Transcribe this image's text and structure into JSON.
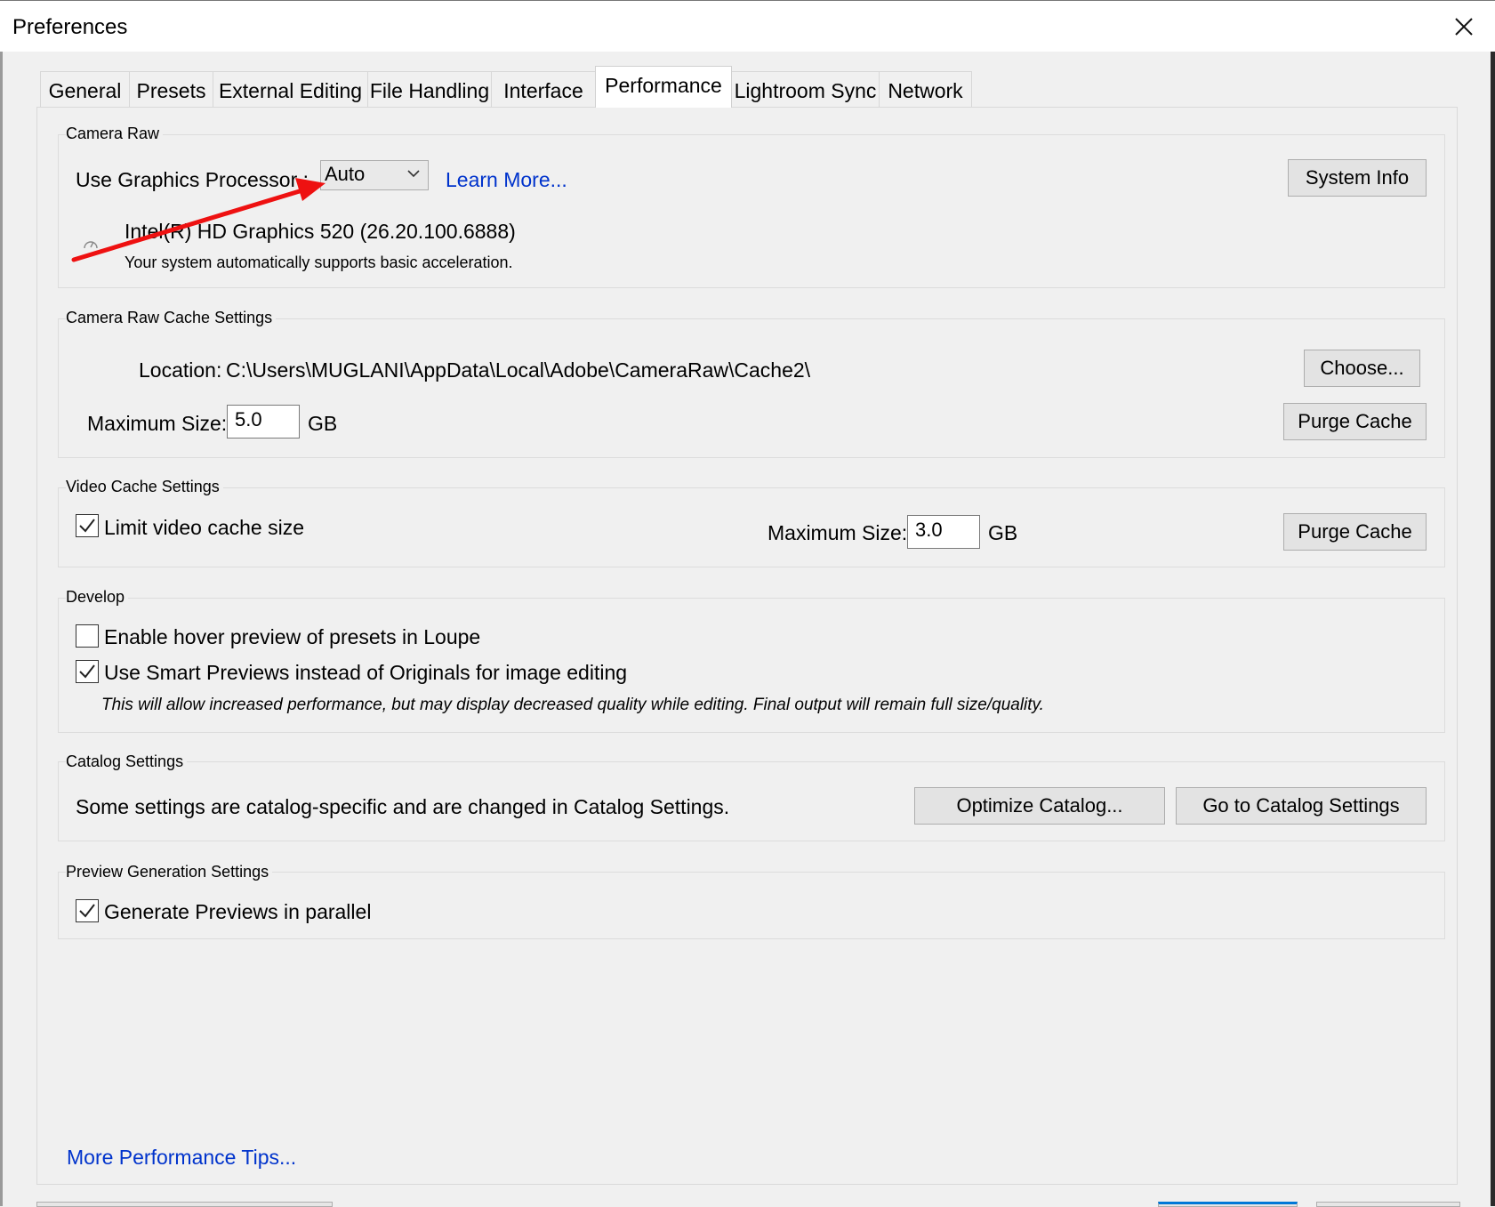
{
  "window": {
    "title": "Preferences"
  },
  "tabs": [
    {
      "label": "General"
    },
    {
      "label": "Presets"
    },
    {
      "label": "External Editing"
    },
    {
      "label": "File Handling"
    },
    {
      "label": "Interface"
    },
    {
      "label": "Performance",
      "active": true
    },
    {
      "label": "Lightroom Sync"
    },
    {
      "label": "Network"
    }
  ],
  "camera_raw": {
    "legend": "Camera Raw",
    "gpu_label": "Use Graphics Processor :",
    "gpu_value": "Auto",
    "learn_more": "Learn More...",
    "system_info": "System Info",
    "gpu_name": "Intel(R) HD Graphics 520 (26.20.100.6888)",
    "gpu_status": "Your system automatically supports basic acceleration."
  },
  "camera_raw_cache": {
    "legend": "Camera Raw Cache Settings",
    "location_label": "Location:",
    "location_value": "C:\\Users\\MUGLANI\\AppData\\Local\\Adobe\\CameraRaw\\Cache2\\",
    "choose": "Choose...",
    "max_size_label": "Maximum Size:",
    "max_size_value": "5.0",
    "unit": "GB",
    "purge": "Purge Cache"
  },
  "video_cache": {
    "legend": "Video Cache Settings",
    "limit_label": "Limit video cache size",
    "limit_checked": true,
    "max_size_label": "Maximum Size:",
    "max_size_value": "3.0",
    "unit": "GB",
    "purge": "Purge Cache"
  },
  "develop": {
    "legend": "Develop",
    "hover_label": "Enable hover preview of presets in Loupe",
    "hover_checked": false,
    "smart_label": "Use Smart Previews instead of Originals for image editing",
    "smart_checked": true,
    "note": "This will allow increased performance, but may display decreased quality while editing. Final output will remain full size/quality."
  },
  "catalog": {
    "legend": "Catalog Settings",
    "text": "Some settings are catalog-specific and are changed in Catalog Settings.",
    "optimize": "Optimize Catalog...",
    "goto": "Go to Catalog Settings"
  },
  "preview": {
    "legend": "Preview Generation Settings",
    "parallel_label": "Generate Previews in parallel",
    "parallel_checked": true
  },
  "footer": {
    "tips_link": "More Performance Tips..."
  },
  "colors": {
    "link": "#0033cc",
    "annotation_arrow": "#ee1111"
  }
}
